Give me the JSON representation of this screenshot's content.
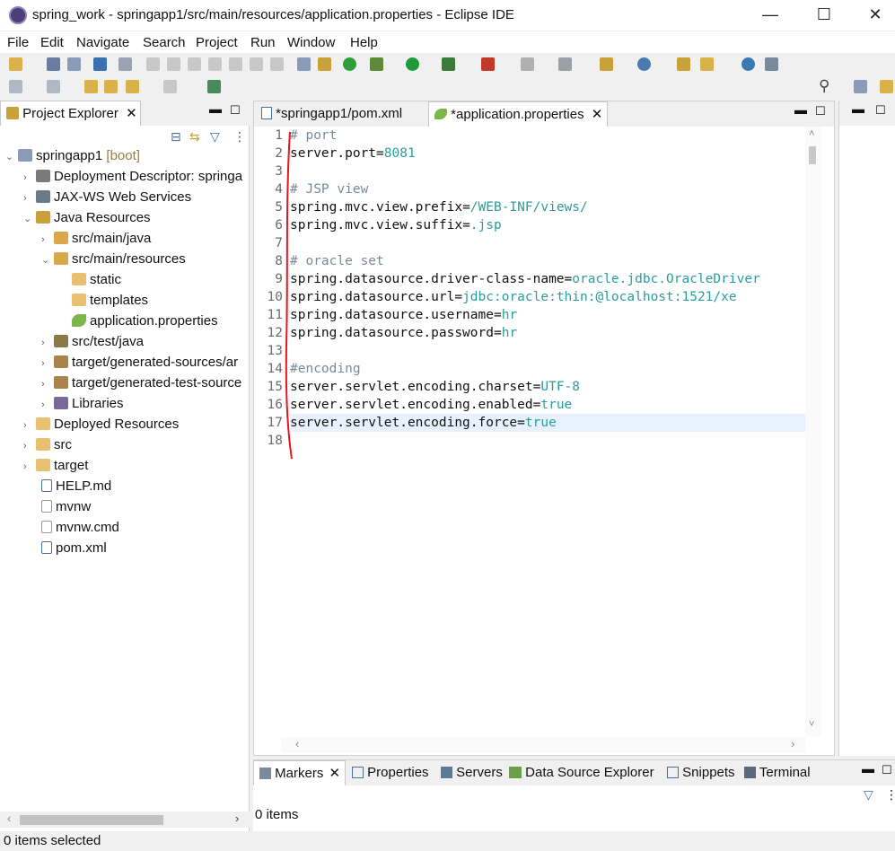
{
  "window": {
    "title": "spring_work - springapp1/src/main/resources/application.properties - Eclipse IDE",
    "minimize": "—",
    "maximize": "☐",
    "close": "✕"
  },
  "menu": [
    "File",
    "Edit",
    "Navigate",
    "Search",
    "Project",
    "Run",
    "Window",
    "Help"
  ],
  "explorer": {
    "tab_label": "Project Explorer",
    "tree": [
      {
        "label": "springapp1",
        "decoration": "[boot]"
      },
      {
        "label": "Deployment Descriptor: springa"
      },
      {
        "label": "JAX-WS Web Services"
      },
      {
        "label": "Java Resources"
      },
      {
        "label": "src/main/java"
      },
      {
        "label": "src/main/resources"
      },
      {
        "label": "static"
      },
      {
        "label": "templates"
      },
      {
        "label": "application.properties"
      },
      {
        "label": "src/test/java"
      },
      {
        "label": "target/generated-sources/ar"
      },
      {
        "label": "target/generated-test-source"
      },
      {
        "label": "Libraries"
      },
      {
        "label": "Deployed Resources"
      },
      {
        "label": "src"
      },
      {
        "label": "target"
      },
      {
        "label": "HELP.md"
      },
      {
        "label": "mvnw"
      },
      {
        "label": "mvnw.cmd"
      },
      {
        "label": "pom.xml"
      }
    ]
  },
  "editor": {
    "tabs": [
      {
        "label": "*springapp1/pom.xml"
      },
      {
        "label": "*application.properties"
      }
    ],
    "lines": [
      {
        "n": "1",
        "key": "# port",
        "sep": "",
        "val": "",
        "comment": true
      },
      {
        "n": "2",
        "key": "server.port",
        "sep": "=",
        "val": "8081"
      },
      {
        "n": "3",
        "key": "",
        "sep": "",
        "val": ""
      },
      {
        "n": "4",
        "key": "# JSP view",
        "sep": "",
        "val": "",
        "comment": true
      },
      {
        "n": "5",
        "key": "spring.mvc.view.prefix",
        "sep": "=",
        "val": "/WEB-INF/views/"
      },
      {
        "n": "6",
        "key": "spring.mvc.view.suffix",
        "sep": "=",
        "val": ".jsp"
      },
      {
        "n": "7",
        "key": "",
        "sep": "",
        "val": ""
      },
      {
        "n": "8",
        "key": "# oracle set",
        "sep": "",
        "val": "",
        "comment": true
      },
      {
        "n": "9",
        "key": "spring.datasource.driver-class-name",
        "sep": "=",
        "val": "oracle.jdbc.OracleDriver"
      },
      {
        "n": "10",
        "key": "spring.datasource.url",
        "sep": "=",
        "val": "jdbc:oracle:thin:@localhost:1521/xe"
      },
      {
        "n": "11",
        "key": "spring.datasource.username",
        "sep": "=",
        "val": "hr"
      },
      {
        "n": "12",
        "key": "spring.datasource.password",
        "sep": "=",
        "val": "hr"
      },
      {
        "n": "13",
        "key": "",
        "sep": "",
        "val": ""
      },
      {
        "n": "14",
        "key": "#encoding",
        "sep": "",
        "val": "",
        "comment": true
      },
      {
        "n": "15",
        "key": "server.servlet.encoding.charset",
        "sep": "=",
        "val": "UTF-8"
      },
      {
        "n": "16",
        "key": "server.servlet.encoding.enabled",
        "sep": "=",
        "val": "true"
      },
      {
        "n": "17",
        "key": "server.servlet.encoding.force",
        "sep": "=",
        "val": "true"
      },
      {
        "n": "18",
        "key": "",
        "sep": "",
        "val": ""
      }
    ]
  },
  "bottom": {
    "tabs": [
      "Markers",
      "Properties",
      "Servers",
      "Data Source Explorer",
      "Snippets",
      "Terminal"
    ],
    "items_count": "0 items"
  },
  "status": {
    "selection": "0 items selected"
  },
  "colors": {
    "string_value": "#2a9d9d",
    "comment": "#7b8a9a",
    "annotation": "#e8141e",
    "selection_bg": "#e8f2fe"
  }
}
